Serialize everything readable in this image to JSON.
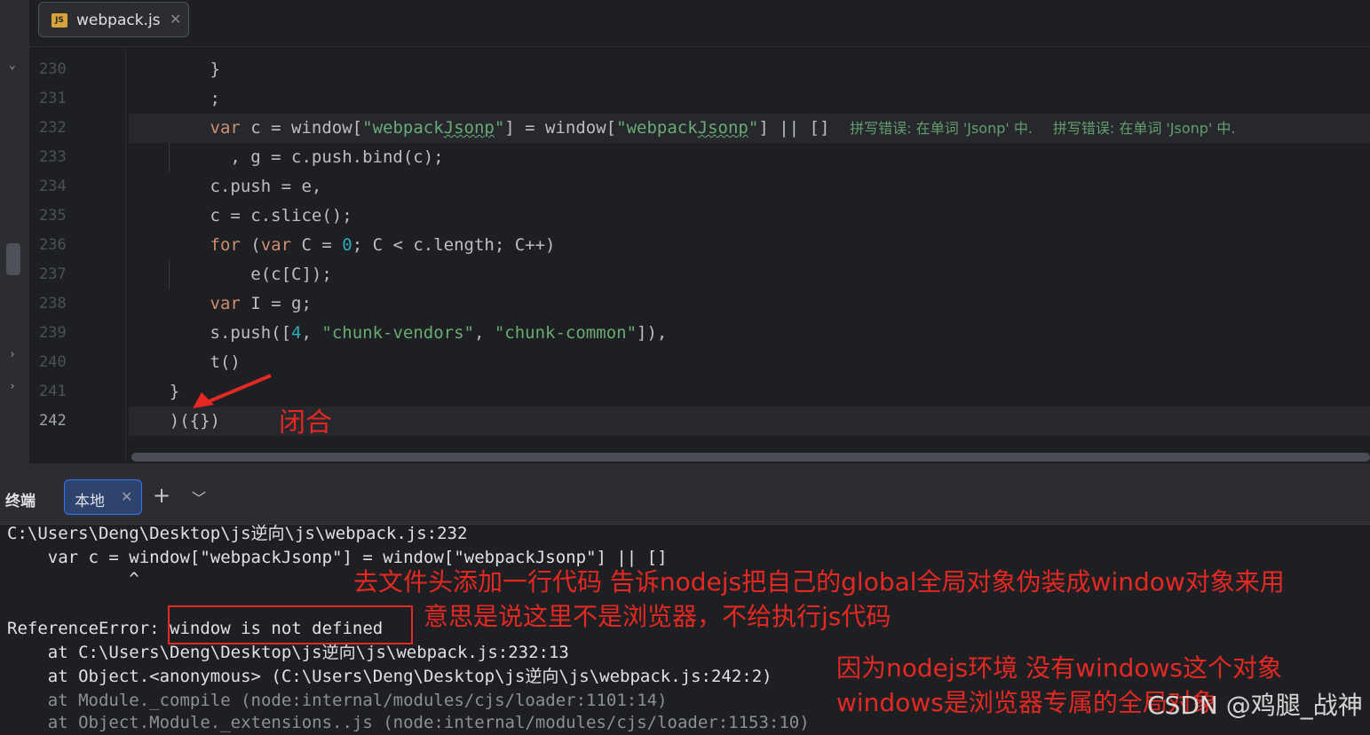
{
  "editor": {
    "tab": {
      "icon": "js-file-icon",
      "icon_text": "JS",
      "name": "webpack.js"
    },
    "lines": [
      {
        "num": "230",
        "text": "        }"
      },
      {
        "num": "231",
        "text": "        ;"
      },
      {
        "num": "232",
        "text": "        var c = window[\"webpackJsonp\"] = window[\"webpackJsonp\"] || []"
      },
      {
        "num": "233",
        "text": "          , g = c.push.bind(c);"
      },
      {
        "num": "234",
        "text": "        c.push = e,"
      },
      {
        "num": "235",
        "text": "        c = c.slice();"
      },
      {
        "num": "236",
        "text": "        for (var C = 0; C < c.length; C++)"
      },
      {
        "num": "237",
        "text": "            e(c[C]);"
      },
      {
        "num": "238",
        "text": "        var I = g;"
      },
      {
        "num": "239",
        "text": "        s.push([4, \"chunk-vendors\", \"chunk-common\"]),"
      },
      {
        "num": "240",
        "text": "        t()"
      },
      {
        "num": "241",
        "text": "    }"
      },
      {
        "num": "242",
        "text": "    )({})"
      }
    ],
    "inlay_hint_1": "拼写错误: 在单词 'Jsonp' 中.",
    "inlay_hint_2": "拼写错误: 在单词 'Jsonp' 中.",
    "annotation_close": "闭合"
  },
  "terminal": {
    "title": "终端",
    "tab_label": "本地",
    "add_icon": "plus-icon",
    "menu_icon": "chevron-down-icon",
    "lines": [
      "C:\\Users\\Deng\\Desktop\\js逆向\\js\\webpack.js:232",
      "    var c = window[\"webpackJsonp\"] = window[\"webpackJsonp\"] || []",
      "            ^",
      "",
      "ReferenceError: window is not defined",
      "    at C:\\Users\\Deng\\Desktop\\js逆向\\js\\webpack.js:232:13",
      "    at Object.<anonymous> (C:\\Users\\Deng\\Desktop\\js逆向\\js\\webpack.js:242:2)",
      "    at Module._compile (node:internal/modules/cjs/loader:1101:14)",
      "    at Object.Module._extensions..js (node:internal/modules/cjs/loader:1153:10)"
    ]
  },
  "annotations": {
    "note1": "去文件头添加一行代码 告诉nodejs把自己的global全局对象伪装成window对象来用",
    "note2": "意思是说这里不是浏览器，不给执行js代码",
    "note3": "因为nodejs环境 没有windows这个对象",
    "note4": "windows是浏览器专属的全局对象",
    "watermark": "CSDN @鸡腿_战神"
  },
  "colors": {
    "background": "#1e1f22",
    "keyword": "#cf8e6d",
    "string": "#6aab73",
    "number": "#2aacb8",
    "annotation_red": "#e52822",
    "tab_accent": "#3574f0"
  }
}
